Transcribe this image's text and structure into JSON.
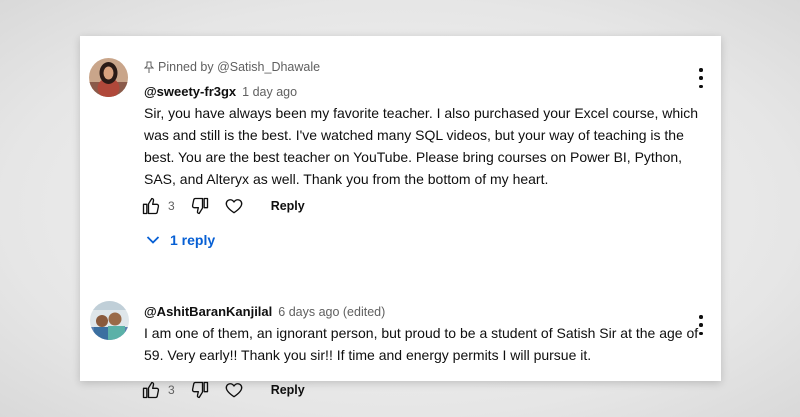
{
  "comments": [
    {
      "pinned_text": "Pinned by @Satish_Dhawale",
      "handle": "@sweety-fr3gx",
      "time": "1 day ago",
      "text": "Sir, you have always been my favorite teacher. I also purchased your Excel course, which was and still is the best. I've watched many SQL videos, but your way of teaching is the best. You are the best teacher on YouTube. Please bring courses on Power BI, Python, SAS, and Alteryx as well. Thank you from the bottom of my heart.",
      "likes": "3",
      "reply_label": "Reply",
      "replies_toggle": "1 reply"
    },
    {
      "handle": "@AshitBaranKanjilal",
      "time": "6 days ago (edited)",
      "text": "I am one of them, an ignorant person, but proud to be a student of Satish Sir at the age of 59. Very early!! Thank you sir!! If time and energy permits I will pursue it.",
      "likes": "3",
      "reply_label": "Reply"
    }
  ],
  "icons": [
    "pin-icon",
    "thumb-up-icon",
    "thumb-down-icon",
    "heart-icon",
    "chevron-down-icon",
    "more-vert-icon"
  ],
  "colors": {
    "link_blue": "#065fd4",
    "secondary_text": "#606060",
    "primary_text": "#0f0f0f"
  }
}
